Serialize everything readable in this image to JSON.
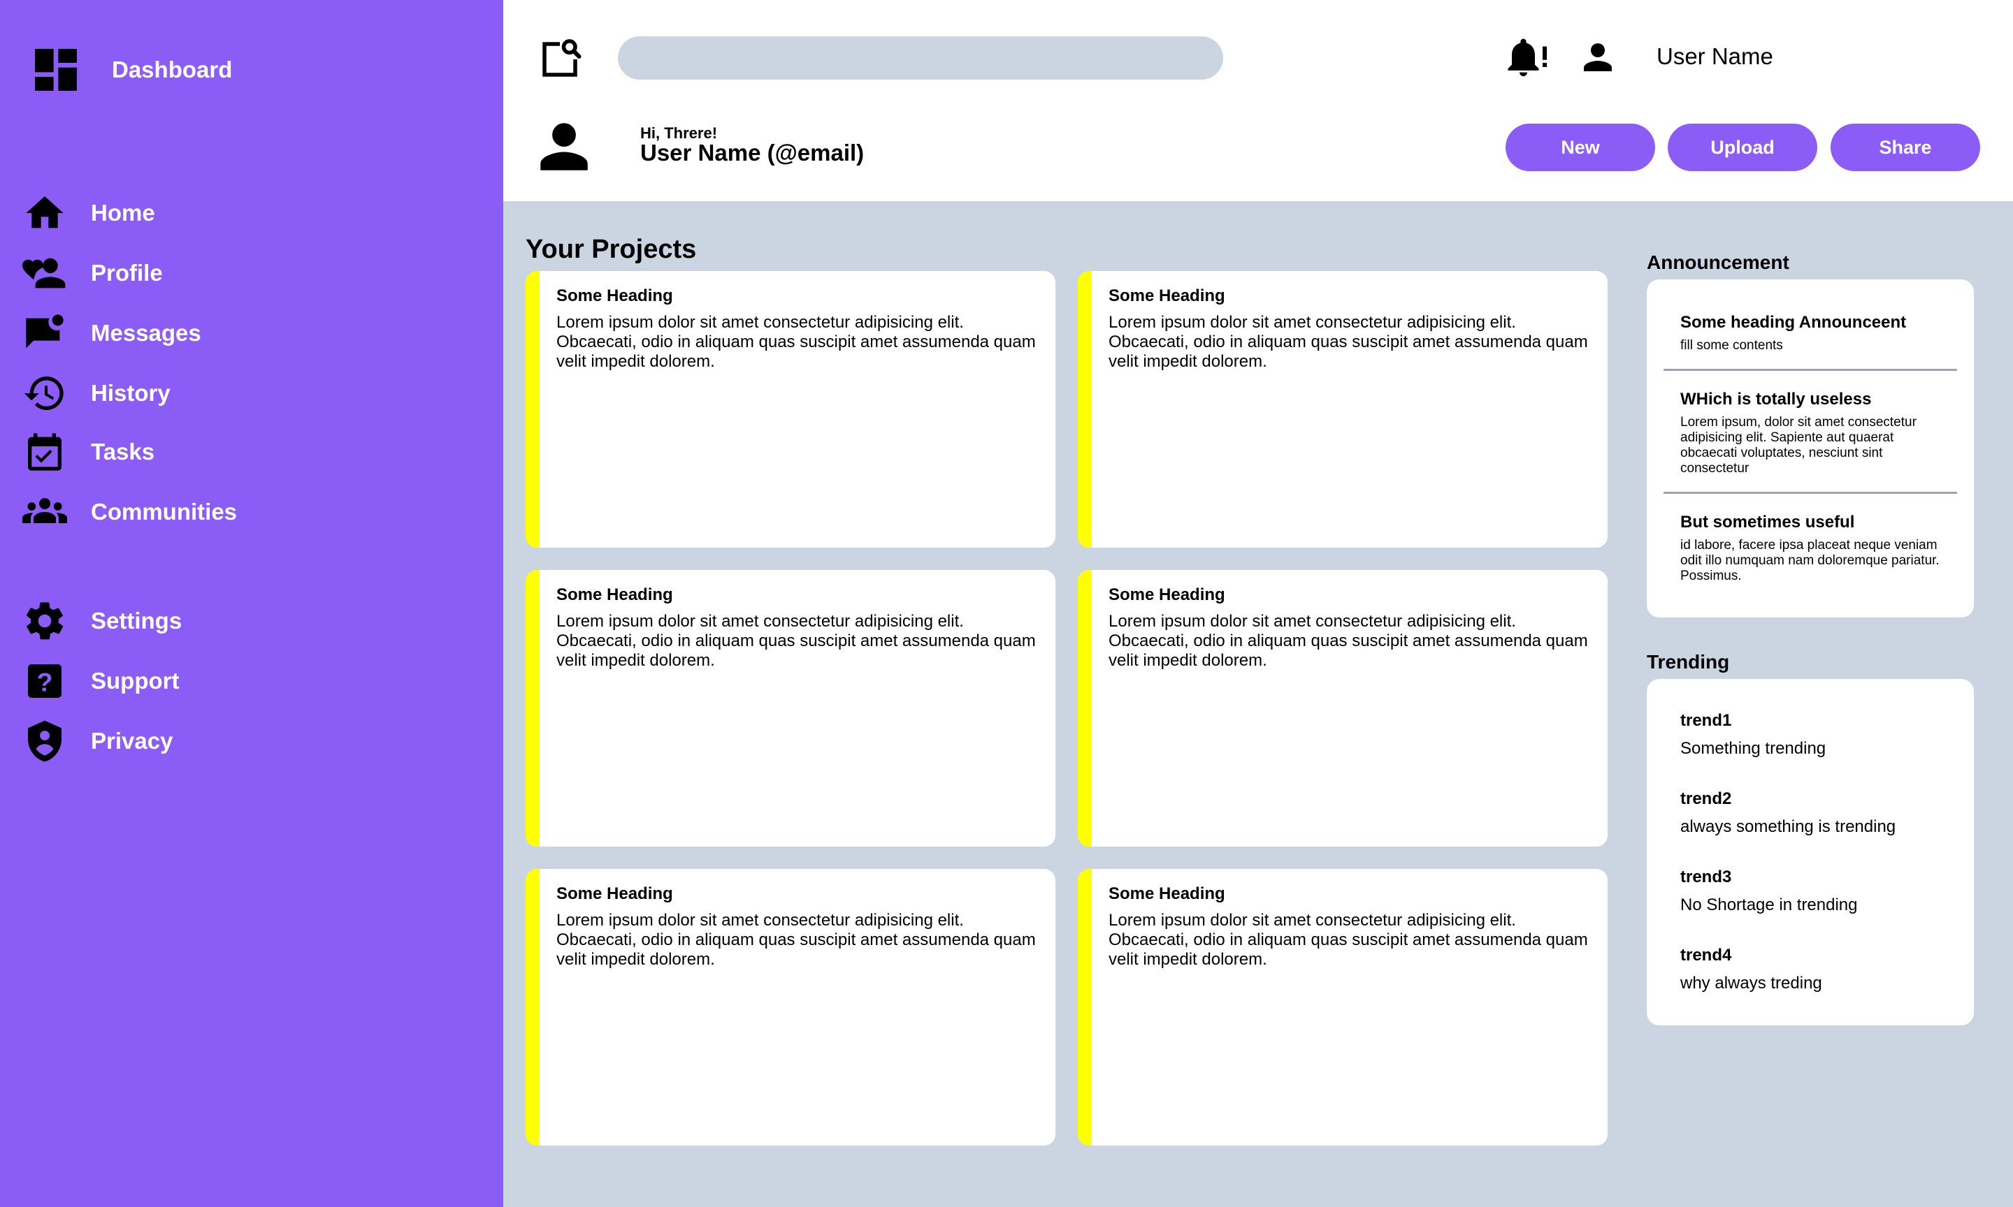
{
  "sidebar": {
    "brand": {
      "label": "Dashboard",
      "icon": "dashboard-icon"
    },
    "nav": [
      {
        "label": "Home",
        "icon": "home-icon"
      },
      {
        "label": "Profile",
        "icon": "profile-icon"
      },
      {
        "label": "Messages",
        "icon": "messages-icon"
      },
      {
        "label": "History",
        "icon": "history-icon"
      },
      {
        "label": "Tasks",
        "icon": "tasks-icon"
      },
      {
        "label": "Communities",
        "icon": "communities-icon"
      }
    ],
    "secondary": [
      {
        "label": "Settings",
        "icon": "gear-icon"
      },
      {
        "label": "Support",
        "icon": "help-icon"
      },
      {
        "label": "Privacy",
        "icon": "shield-icon"
      }
    ]
  },
  "header": {
    "search_placeholder": "",
    "user_name": "User Name",
    "greeting": "Hi, Threre!",
    "identity": "User Name (@email)",
    "buttons": {
      "new": "New",
      "upload": "Upload",
      "share": "Share"
    }
  },
  "projects": {
    "title": "Your Projects",
    "cards": [
      {
        "heading": "Some Heading",
        "body": "Lorem ipsum dolor sit amet consectetur adipisicing elit. Obcaecati, odio in aliquam quas suscipit amet assumenda quam velit impedit dolorem."
      },
      {
        "heading": "Some Heading",
        "body": "Lorem ipsum dolor sit amet consectetur adipisicing elit. Obcaecati, odio in aliquam quas suscipit amet assumenda quam velit impedit dolorem."
      },
      {
        "heading": "Some Heading",
        "body": "Lorem ipsum dolor sit amet consectetur adipisicing elit. Obcaecati, odio in aliquam quas suscipit amet assumenda quam velit impedit dolorem."
      },
      {
        "heading": "Some Heading",
        "body": "Lorem ipsum dolor sit amet consectetur adipisicing elit. Obcaecati, odio in aliquam quas suscipit amet assumenda quam velit impedit dolorem."
      },
      {
        "heading": "Some Heading",
        "body": "Lorem ipsum dolor sit amet consectetur adipisicing elit. Obcaecati, odio in aliquam quas suscipit amet assumenda quam velit impedit dolorem."
      },
      {
        "heading": "Some Heading",
        "body": "Lorem ipsum dolor sit amet consectetur adipisicing elit. Obcaecati, odio in aliquam quas suscipit amet assumenda quam velit impedit dolorem."
      }
    ]
  },
  "announcement": {
    "title": "Announcement",
    "items": [
      {
        "heading": "Some heading Announceent",
        "text": "fill some contents"
      },
      {
        "heading": "WHich is totally useless",
        "text": "Lorem ipsum, dolor sit amet consectetur adipisicing elit. Sapiente aut quaerat obcaecati voluptates, nesciunt sint consectetur"
      },
      {
        "heading": "But sometimes useful",
        "text": "id labore, facere ipsa placeat neque veniam odit illo numquam nam doloremque pariatur. Possimus."
      }
    ]
  },
  "trending": {
    "title": "Trending",
    "items": [
      {
        "heading": "trend1",
        "text": "Something trending"
      },
      {
        "heading": "trend2",
        "text": "always something is trending"
      },
      {
        "heading": "trend3",
        "text": "No Shortage in trending"
      },
      {
        "heading": "trend4",
        "text": "why always treding"
      }
    ]
  },
  "colors": {
    "accent": "#8b5cf6",
    "background": "#cbd5e1",
    "card_stripe": "#ffff00"
  }
}
